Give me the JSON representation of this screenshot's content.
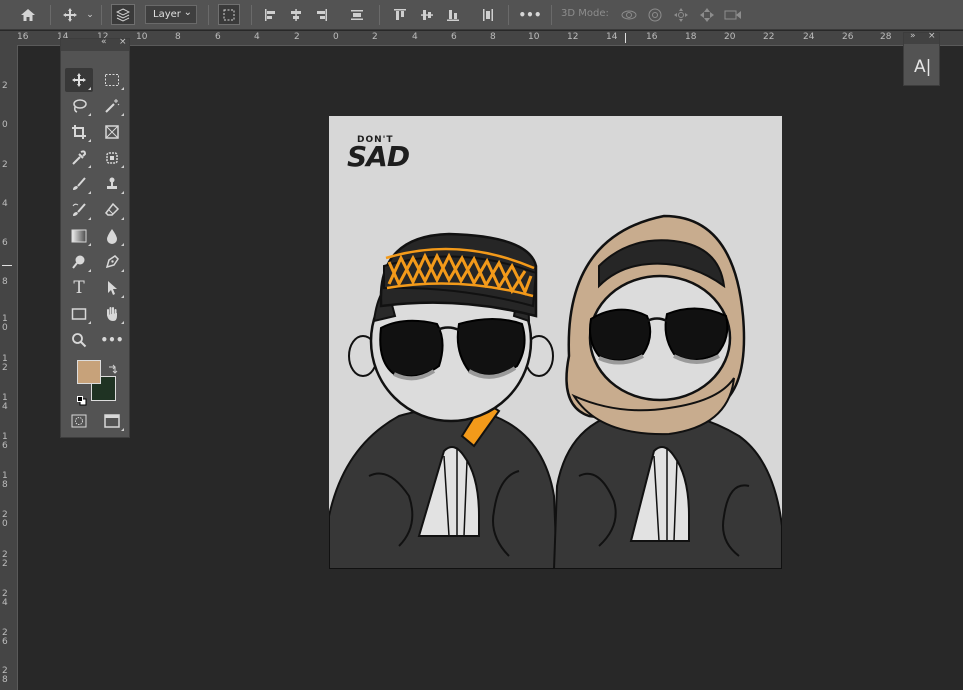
{
  "options_bar": {
    "icons": [
      "home-icon",
      "move-icon",
      "chevron-down-icon",
      "auto-select-icon",
      "transform-controls-icon",
      "align-left-icon",
      "align-hcenter-icon",
      "align-right-icon",
      "distribute-icon",
      "align-top-icon",
      "align-vcenter-icon",
      "align-bottom-icon",
      "distribute-vertical-icon",
      "more-icon",
      "orbit-3d-icon",
      "roll-3d-icon",
      "pan-3d-icon",
      "slide-3d-icon",
      "video-camera-icon"
    ],
    "layer_select": "Layer",
    "more_label": "•••",
    "mode_3d": "3D Mode:"
  },
  "ruler_h": [
    "16",
    "14",
    "12",
    "10",
    "8",
    "6",
    "4",
    "2",
    "0",
    "2",
    "4",
    "6",
    "8",
    "10",
    "12",
    "14",
    "16",
    "18",
    "20",
    "22",
    "24",
    "26",
    "28"
  ],
  "ruler_v": [
    "2",
    "0",
    "2",
    "4",
    "6",
    "8",
    "1 0",
    "1 2",
    "1 4",
    "1 6",
    "1 8",
    "2 0",
    "2 2",
    "2 4",
    "2 6",
    "2 8"
  ],
  "tools_panel": {
    "collapse": "«",
    "close": "×",
    "tools": [
      "move-tool-icon",
      "rect-marquee-icon",
      "lasso-icon",
      "magic-wand-icon",
      "crop-icon",
      "frame-icon",
      "eyedropper-icon",
      "healing-brush-icon",
      "brush-icon",
      "clone-stamp-icon",
      "history-brush-icon",
      "eraser-icon",
      "gradient-icon",
      "blur-drop-icon",
      "dodge-icon",
      "pen-icon",
      "type-icon",
      "path-select-icon",
      "rectangle-icon",
      "hand-icon",
      "zoom-icon",
      "more-tools-icon"
    ],
    "type_label": "T",
    "more_label": "•••",
    "foreground_color": "#c7a27a",
    "background_color": "#1f3323"
  },
  "canvas": {
    "logo_top": "DON'T",
    "logo_bottom": "SAD"
  },
  "character_panel": {
    "expand": "»",
    "close": "×",
    "label": "A|"
  }
}
